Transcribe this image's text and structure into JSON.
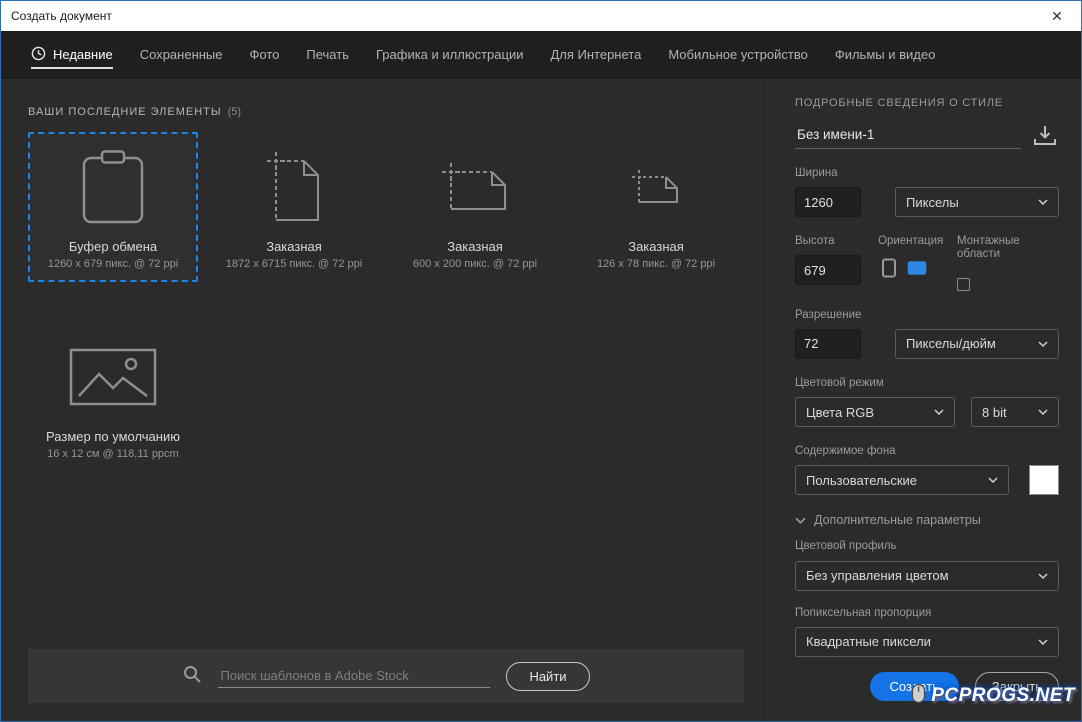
{
  "window": {
    "title": "Создать документ",
    "close_glyph": "✕"
  },
  "tabs": [
    {
      "label": "Недавние"
    },
    {
      "label": "Сохраненные"
    },
    {
      "label": "Фото"
    },
    {
      "label": "Печать"
    },
    {
      "label": "Графика и иллюстрации"
    },
    {
      "label": "Для Интернета"
    },
    {
      "label": "Мобильное устройство"
    },
    {
      "label": "Фильмы и видео"
    }
  ],
  "recent": {
    "heading": "ВАШИ ПОСЛЕДНИЕ ЭЛЕМЕНТЫ",
    "count": "(5)",
    "items": [
      {
        "name": "Буфер обмена",
        "spec": "1260 x 679 пикс. @ 72 ppi",
        "icon": "clipboard-icon",
        "selected": true
      },
      {
        "name": "Заказная",
        "spec": "1872 x 6715 пикс. @ 72 ppi",
        "icon": "custom-portrait-icon",
        "selected": false
      },
      {
        "name": "Заказная",
        "spec": "600 x 200 пикс. @ 72 ppi",
        "icon": "custom-landscape-icon",
        "selected": false
      },
      {
        "name": "Заказная",
        "spec": "126 x 78 пикс. @ 72 ppi",
        "icon": "custom-small-icon",
        "selected": false
      },
      {
        "name": "Размер по умолчанию",
        "spec": "16 x 12 см @ 118,11 ppcm",
        "icon": "image-icon",
        "selected": false
      }
    ]
  },
  "search": {
    "placeholder": "Поиск шаблонов в Adobe Stock",
    "button_label": "Найти"
  },
  "panel": {
    "heading": "ПОДРОБНЫЕ СВЕДЕНИЯ О СТИЛЕ",
    "doc_name": "Без имени-1",
    "width_label": "Ширина",
    "width_value": "1260",
    "width_unit": "Пикселы",
    "height_label": "Высота",
    "height_value": "679",
    "orientation_label": "Ориентация",
    "artboards_label": "Монтажные области",
    "resolution_label": "Разрешение",
    "resolution_value": "72",
    "resolution_unit": "Пикселы/дюйм",
    "color_mode_label": "Цветовой режим",
    "color_mode_value": "Цвета RGB",
    "bit_depth_value": "8 bit",
    "background_label": "Содержимое фона",
    "background_value": "Пользовательские",
    "advanced_label": "Дополнительные параметры",
    "profile_label": "Цветовой профиль",
    "profile_value": "Без управления цветом",
    "pixel_ratio_label": "Попиксельная пропорция",
    "pixel_ratio_value": "Квадратные пиксели",
    "create_label": "Создать",
    "close_label": "Закрыть"
  },
  "watermark": {
    "text": "PCPROGS.NET"
  },
  "colors": {
    "accent": "#1473e6",
    "selection_border": "#1d84e8",
    "titlebar_bg": "#ffffff",
    "dialog_bg": "#2b2b2b"
  }
}
